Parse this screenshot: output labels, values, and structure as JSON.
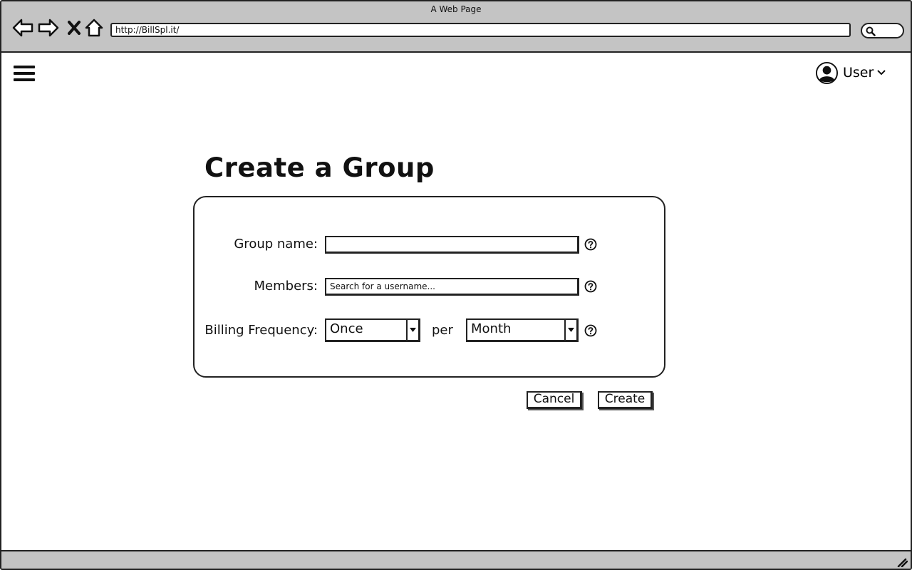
{
  "browser": {
    "window_title": "A Web Page",
    "url": "http://BillSpl.it/",
    "icons": [
      "back-arrow-icon",
      "forward-arrow-icon",
      "close-icon",
      "home-icon",
      "search-icon"
    ]
  },
  "header": {
    "menu_icon": "hamburger-menu-icon",
    "user_icon": "user-avatar-icon",
    "user_label": "User",
    "user_chevron_icon": "chevron-down-icon"
  },
  "page": {
    "title": "Create a Group"
  },
  "form": {
    "group_name": {
      "label": "Group name:",
      "value": "",
      "placeholder": ""
    },
    "members": {
      "label": "Members:",
      "value": "",
      "placeholder": "Search for a username..."
    },
    "billing": {
      "label": "Billing Frequency:",
      "count_value": "Once",
      "per_text": "per",
      "period_value": "Month"
    },
    "help_icon": "question-circle-icon"
  },
  "actions": {
    "cancel_label": "Cancel",
    "create_label": "Create"
  },
  "colors": {
    "chrome_gray": "#c4c4c4",
    "border": "#222222",
    "background": "#ffffff"
  }
}
